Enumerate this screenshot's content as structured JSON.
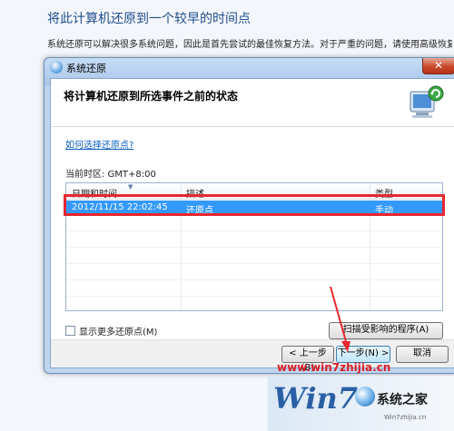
{
  "background": {
    "title": "将此计算机还原到一个较早的时间点",
    "description": "系统还原可以解决很多系统问题，因此是首先尝试的最佳恢复方法。对于严重的问题，请使用高级恢复方法。"
  },
  "dialog": {
    "title": "系统还原",
    "heading": "将计算机还原到所选事件之前的状态",
    "help_link": "如何选择还原点?",
    "timezone": "当前时区: GMT+8:00",
    "table": {
      "columns": [
        "日期和时间",
        "描述",
        "类型"
      ],
      "rows": [
        {
          "date": "2012/11/15 22:02:45",
          "description": "还原点",
          "type": "手动"
        }
      ]
    },
    "show_more_label": "显示更多还原点(M)",
    "scan_button": "扫描受影响的程序(A)",
    "back_button": "< 上一步(B)",
    "next_button": "下一步(N) >",
    "cancel_button": "取消"
  },
  "watermark": {
    "url": "www.win7zhijia.cn",
    "logo_text": "Win7",
    "logo_cn": "系统之家"
  },
  "colors": {
    "selection": "#3399ff",
    "annotation_red": "#e8262f",
    "link": "#0c5fc1"
  }
}
